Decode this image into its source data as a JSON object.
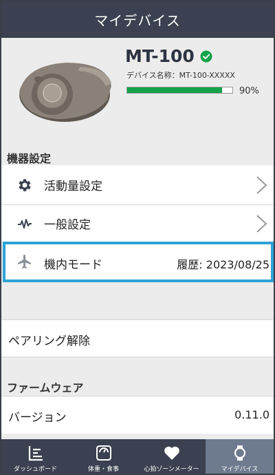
{
  "header": {
    "title": "マイデバイス"
  },
  "device": {
    "model": "MT-100",
    "name_label": "デバイス名称：MT-100-XXXXX",
    "battery_percent_text": "90%",
    "battery_level": 0.9,
    "status_icon": "verified-check-icon"
  },
  "sections": {
    "device_settings": {
      "title": "機器設定",
      "items": [
        {
          "label": "活動量設定",
          "icon": "gear-icon"
        },
        {
          "label": "一般設定",
          "icon": "waveform-icon"
        }
      ]
    },
    "airplane": {
      "label": "機内モード",
      "history": "履歴: 2023/08/25",
      "icon": "airplane-icon"
    },
    "pairing": {
      "label": "ペアリング解除"
    },
    "firmware": {
      "title": "ファームウェア",
      "version_label": "バージョン",
      "version_value": "0.11.0"
    }
  },
  "tabbar": {
    "items": [
      {
        "label": "ダッシュボード",
        "icon": "dashboard-icon",
        "active": false
      },
      {
        "label": "体重・食事",
        "icon": "scale-icon",
        "active": false
      },
      {
        "label": "心拍ゾーンメーター",
        "icon": "heart-icon",
        "active": false
      },
      {
        "label": "マイデバイス",
        "icon": "watch-icon",
        "active": true
      }
    ]
  },
  "colors": {
    "header_bg": "#3b4150",
    "accent_green": "#16a24a",
    "highlight_border": "#2ea3d7",
    "tab_active_bg": "#6e7b8f"
  }
}
